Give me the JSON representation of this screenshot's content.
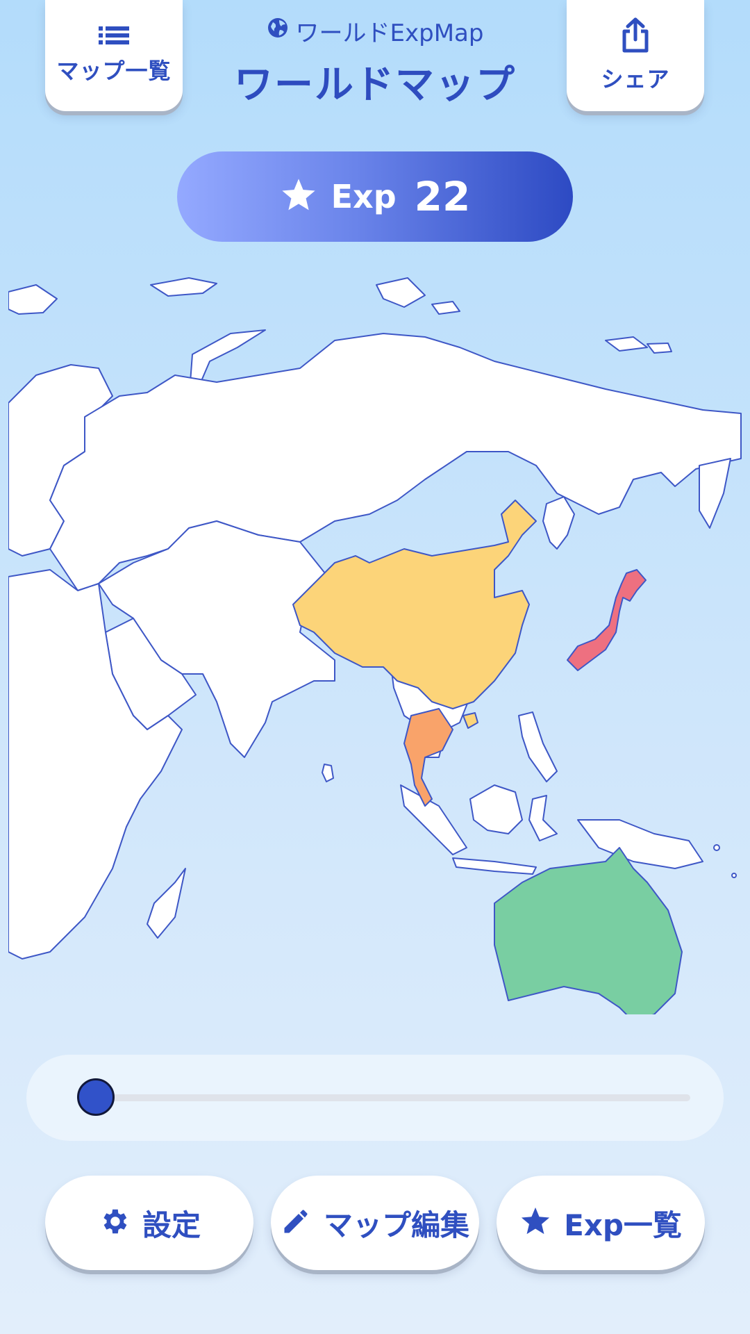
{
  "header": {
    "app_name": "ワールドExpMap",
    "title": "ワールドマップ",
    "maplist_label": "マップ一覧",
    "share_label": "シェア"
  },
  "exp": {
    "label": "Exp",
    "value": "22"
  },
  "map": {
    "colored_countries": [
      {
        "name": "China",
        "color": "#fcd479"
      },
      {
        "name": "Japan",
        "color": "#ee7080"
      },
      {
        "name": "Thailand",
        "color": "#f9a36a"
      },
      {
        "name": "Australia",
        "color": "#79cea2"
      }
    ],
    "border_color": "#3e57c6",
    "land_color": "#ffffff"
  },
  "slider": {
    "value": 0
  },
  "footer": {
    "settings_label": "設定",
    "edit_label": "マップ編集",
    "explist_label": "Exp一覧"
  },
  "colors": {
    "accent": "#2f4fc0",
    "background_top": "#b3dcfb",
    "background_bottom": "#e2eefb"
  }
}
